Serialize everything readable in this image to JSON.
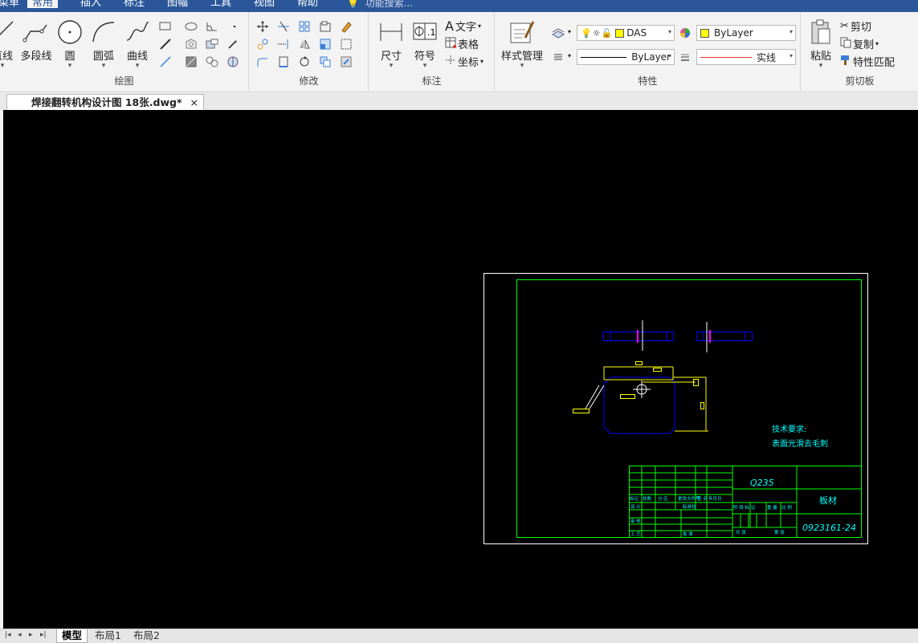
{
  "menu": {
    "items": [
      "菜单",
      "常用",
      "插入",
      "标注",
      "图幅",
      "工具",
      "视图",
      "帮助"
    ],
    "active": "常用",
    "search": "功能搜索..."
  },
  "ribbon": {
    "draw": {
      "title": "绘图",
      "line": "直线",
      "polyline": "多段线",
      "circle": "圆",
      "arc": "圆弧",
      "curve": "曲线"
    },
    "modify": {
      "title": "修改"
    },
    "annotate": {
      "title": "标注",
      "dimension": "尺寸",
      "symbol": "符号",
      "text": "文字",
      "table": "表格",
      "coordinate": "坐标"
    },
    "properties": {
      "title": "特性",
      "style_manager": "样式管理",
      "layer_name": "DAS",
      "color_value": "ByLayer",
      "linetype_value": "ByLayer",
      "lineweight_value": "实线"
    },
    "clipboard": {
      "title": "剪切板",
      "paste": "粘贴",
      "cut": "剪切",
      "copy": "复制",
      "match": "特性匹配"
    }
  },
  "document": {
    "tab_title": "焊接翻转机构设计图 18张.dwg*",
    "close": "×"
  },
  "drawing": {
    "tech_title": "技术要求:",
    "tech_req": "表面光滑去毛刺",
    "material": "Q235",
    "part_name": "板材",
    "drawing_no": "0923161-24",
    "tb_labels": [
      "标记",
      "处数",
      "分 区",
      "更改文件号",
      "签 名",
      "年月日",
      "设 计",
      "标准化",
      "阶 段 标 记",
      "重 量",
      "比 例",
      "审 核",
      "工 艺",
      "批 准",
      "共 张",
      "第 张"
    ]
  },
  "layouts": {
    "tabs": [
      "模型",
      "布局1",
      "布局2"
    ],
    "active": "模型"
  },
  "colors": {
    "menubar": "#2b579a",
    "canvas": "#000000",
    "frame": "#00ff00",
    "cyan": "#00ffff",
    "yellow": "#ffff00",
    "blue": "#0000ff",
    "magenta": "#ff00ff"
  }
}
